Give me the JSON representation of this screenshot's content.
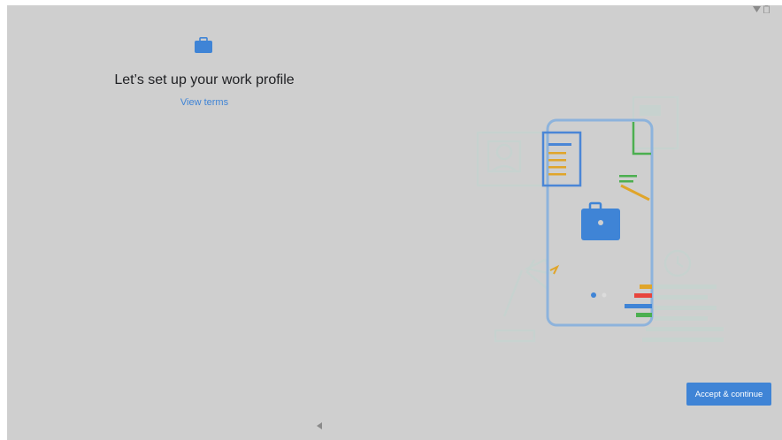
{
  "setup": {
    "title": "Let’s set up your work profile",
    "view_terms_label": "View terms"
  },
  "actions": {
    "accept_label": "Accept & continue"
  },
  "icons": {
    "status": [
      "wifi-icon",
      "battery-icon"
    ],
    "header": "briefcase-icon",
    "navigation": "back-triangle-icon"
  },
  "colors": {
    "accent": "#3f84d6",
    "background": "#cfcfcf"
  }
}
